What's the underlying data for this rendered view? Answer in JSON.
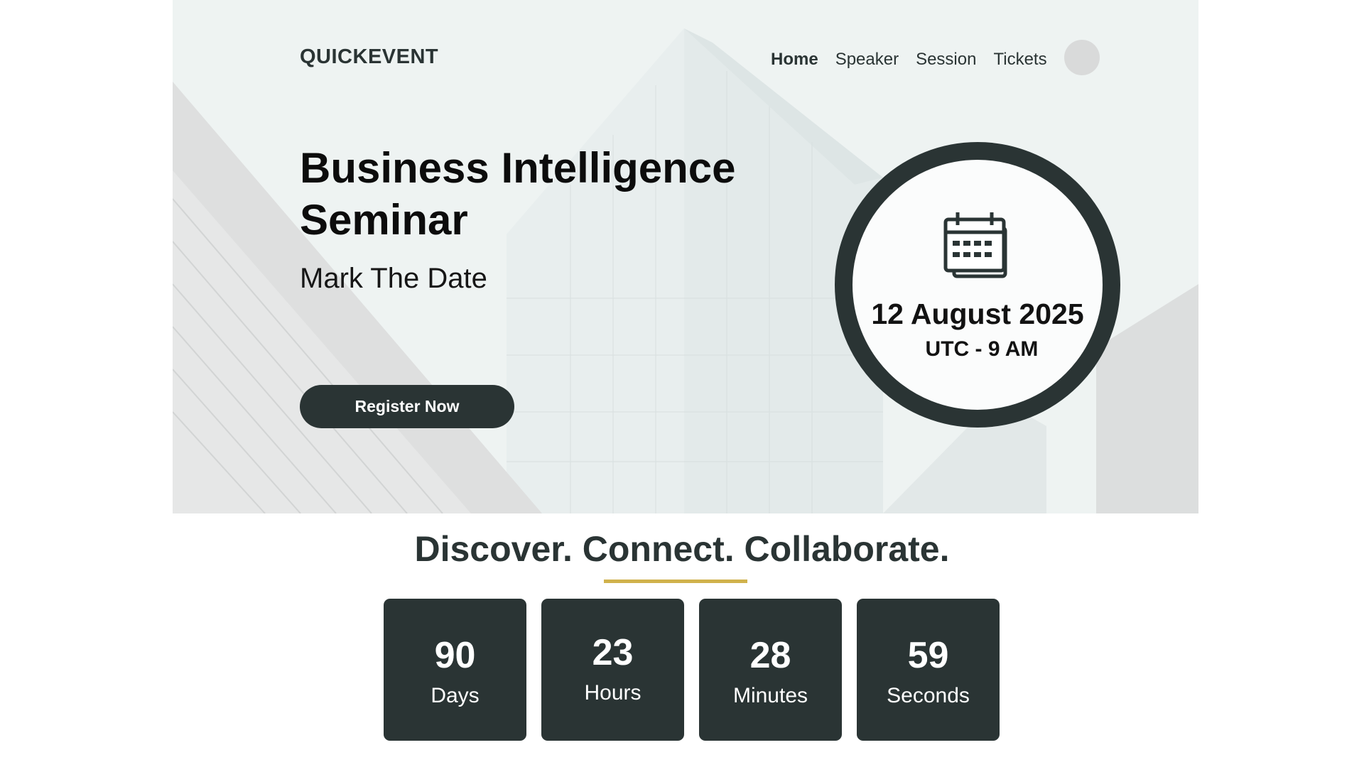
{
  "header": {
    "brand": "QUICKEVENT",
    "nav": [
      {
        "label": "Home",
        "active": true
      },
      {
        "label": "Speaker",
        "active": false
      },
      {
        "label": "Session",
        "active": false
      },
      {
        "label": "Tickets",
        "active": false
      }
    ]
  },
  "hero": {
    "title_line1": "Business Intelligence",
    "title_line2": "Seminar",
    "subtitle": "Mark The Date",
    "register_label": "Register Now",
    "background_image": "city-buildings-photo"
  },
  "event": {
    "icon": "calendar-icon",
    "date": "12 August 2025",
    "time": "UTC - 9 AM"
  },
  "tagline": "Discover. Connect. Collaborate.",
  "countdown": [
    {
      "value": "90",
      "label": "Days"
    },
    {
      "value": "23",
      "label": "Hours"
    },
    {
      "value": "28",
      "label": "Minutes"
    },
    {
      "value": "59",
      "label": "Seconds"
    }
  ],
  "colors": {
    "primary_dark": "#2a3434",
    "accent_gold": "#d0b24c",
    "hero_bg": "#eef3f2",
    "avatar_gray": "#d9dada"
  }
}
